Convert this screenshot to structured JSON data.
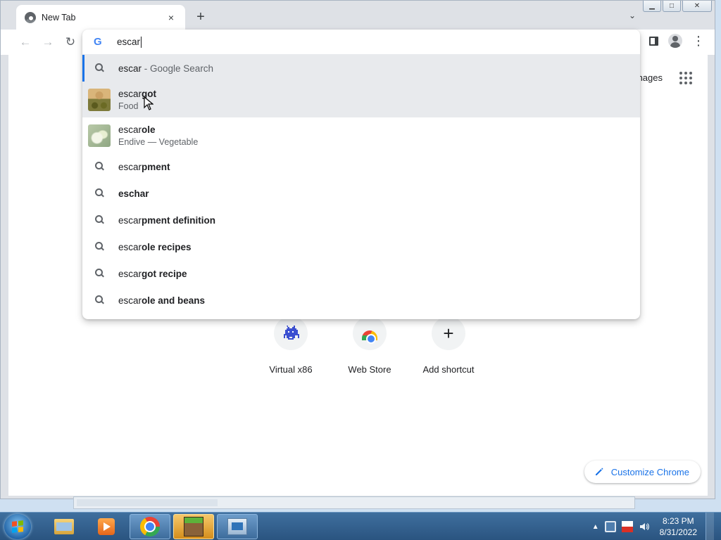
{
  "browser": {
    "tab": {
      "title": "New Tab",
      "close_glyph": "×"
    },
    "new_tab_glyph": "+",
    "tab_search_glyph": "⌄",
    "window_controls": {
      "minimize": "▁",
      "maximize": "□",
      "close": "✕"
    },
    "nav": {
      "back": "←",
      "forward": "→",
      "reload": "↻"
    }
  },
  "omnibox": {
    "logo": "G",
    "query": "escar",
    "suggestions": [
      {
        "type": "search",
        "typed": "escar",
        "completion": "",
        "desc": " - Google Search",
        "state": "selected"
      },
      {
        "type": "entity",
        "typed": "escar",
        "completion": "got",
        "sub": "Food",
        "thumb": "escargot",
        "state": "hover"
      },
      {
        "type": "entity",
        "typed": "escar",
        "completion": "ole",
        "sub": "Endive — Vegetable",
        "thumb": "escarole",
        "state": ""
      },
      {
        "type": "search",
        "typed": "escar",
        "completion": "pment",
        "desc": "",
        "state": ""
      },
      {
        "type": "search",
        "typed": "",
        "completion": "eschar",
        "desc": "",
        "state": ""
      },
      {
        "type": "search",
        "typed": "escar",
        "completion": "pment definition",
        "desc": "",
        "state": ""
      },
      {
        "type": "search",
        "typed": "escar",
        "completion": "ole recipes",
        "desc": "",
        "state": ""
      },
      {
        "type": "search",
        "typed": "escar",
        "completion": "got recipe",
        "desc": "",
        "state": ""
      },
      {
        "type": "search",
        "typed": "escar",
        "completion": "ole and beans",
        "desc": "",
        "state": ""
      }
    ]
  },
  "ntp": {
    "images_link": "nages",
    "shortcuts": [
      {
        "title": "Virtual x86",
        "icon": "invader-icon"
      },
      {
        "title": "Web Store",
        "icon": "webstore-icon"
      },
      {
        "title": "Add shortcut",
        "icon": "plus-icon",
        "glyph": "+"
      }
    ],
    "customize_label": "Customize Chrome"
  },
  "taskbar": {
    "clock_time": "8:23 PM",
    "clock_date": "8/31/2022",
    "tray_arrow": "▲"
  },
  "colors": {
    "accent": "#1a73e8",
    "selection_bg": "#e8eaed",
    "taskbar": "#2a5480"
  }
}
